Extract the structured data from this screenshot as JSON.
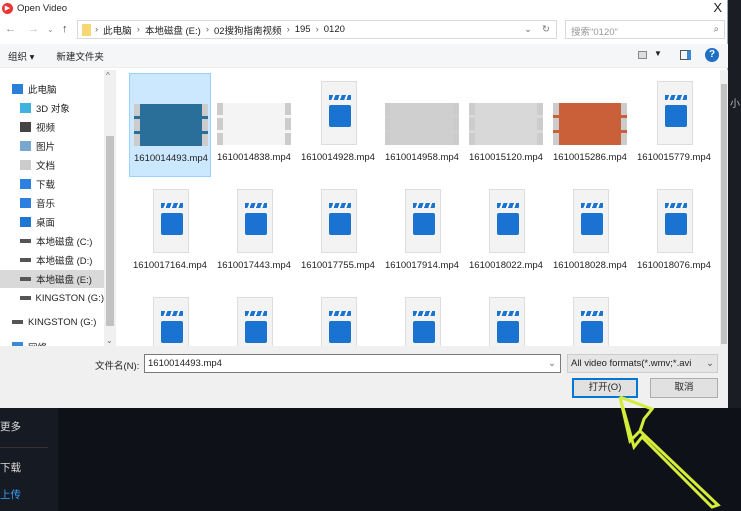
{
  "window": {
    "title": "Open Video",
    "close": "X"
  },
  "address": {
    "crumbs": [
      "此电脑",
      "本地磁盘 (E:)",
      "02搜狗指南视频",
      "195",
      "0120"
    ],
    "search_placeholder": "搜索\"0120\""
  },
  "toolbar": {
    "organize": "组织 ▾",
    "new_folder": "新建文件夹",
    "help": "?"
  },
  "nav": [
    {
      "label": "此电脑",
      "icon": "computer-icon",
      "indent": 0
    },
    {
      "label": "3D 对象",
      "icon": "cube-icon",
      "indent": 1
    },
    {
      "label": "视频",
      "icon": "video-icon",
      "indent": 1
    },
    {
      "label": "图片",
      "icon": "picture-icon",
      "indent": 1
    },
    {
      "label": "文档",
      "icon": "document-icon",
      "indent": 1
    },
    {
      "label": "下载",
      "icon": "download-icon",
      "indent": 1
    },
    {
      "label": "音乐",
      "icon": "music-icon",
      "indent": 1
    },
    {
      "label": "桌面",
      "icon": "desktop-icon",
      "indent": 1
    },
    {
      "label": "本地磁盘 (C:)",
      "icon": "drive-icon",
      "indent": 1
    },
    {
      "label": "本地磁盘 (D:)",
      "icon": "drive-icon",
      "indent": 1
    },
    {
      "label": "本地磁盘 (E:)",
      "icon": "drive-icon",
      "indent": 1,
      "selected": true
    },
    {
      "label": "KINGSTON (G:)",
      "icon": "usb-drive-icon",
      "indent": 1
    },
    {
      "label": "KINGSTON (G:)",
      "icon": "usb-drive-icon",
      "indent": 0
    },
    {
      "label": "网络",
      "icon": "network-icon",
      "indent": 0
    }
  ],
  "files": [
    {
      "name": "1610014493.mp4",
      "thumb": true,
      "selected": true,
      "color": "#2a6f9a"
    },
    {
      "name": "1610014838.mp4",
      "thumb": true,
      "color": "#f4f4f4"
    },
    {
      "name": "1610014928.mp4"
    },
    {
      "name": "1610014958.mp4",
      "thumb": true,
      "color": "#cfcfcf"
    },
    {
      "name": "1610015120.mp4",
      "thumb": true,
      "color": "#d8d8d8"
    },
    {
      "name": "1610015286.mp4",
      "thumb": true,
      "color": "#c9603a"
    },
    {
      "name": "1610015779.mp4"
    },
    {
      "name": "1610017164.mp4"
    },
    {
      "name": "1610017443.mp4"
    },
    {
      "name": "1610017755.mp4"
    },
    {
      "name": "1610017914.mp4"
    },
    {
      "name": "1610018022.mp4"
    },
    {
      "name": "1610018028.mp4"
    },
    {
      "name": "1610018076.mp4"
    },
    {
      "name": ""
    },
    {
      "name": ""
    },
    {
      "name": ""
    },
    {
      "name": ""
    },
    {
      "name": ""
    },
    {
      "name": ""
    }
  ],
  "bottom": {
    "filename_label": "文件名(N):",
    "filename_value": "1610014493.mp4",
    "filter": "All video formats(*.wmv;*.avi",
    "open": "打开(O)",
    "cancel": "取消"
  },
  "background": {
    "items": [
      "更多",
      "下载",
      "上传"
    ],
    "right_text": "小"
  },
  "colors": {
    "accent": "#0078d7",
    "arrow": "#d4ec3a",
    "active": "#3aa0ff"
  }
}
